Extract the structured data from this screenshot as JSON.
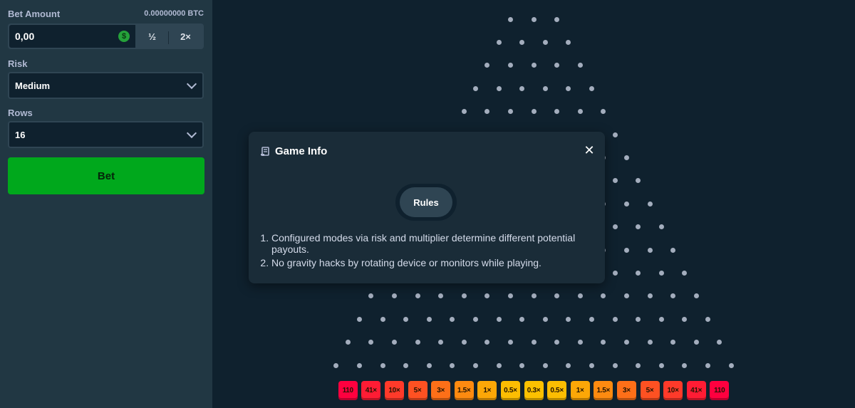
{
  "bet": {
    "label": "Bet Amount",
    "balance": "0.00000000 BTC",
    "value": "0,00",
    "coin_icon": "dollar-coin-icon",
    "half_label": "½",
    "double_label": "2×"
  },
  "risk": {
    "label": "Risk",
    "value": "Medium"
  },
  "rows": {
    "label": "Rows",
    "value": "16"
  },
  "bet_button": {
    "label": "Bet"
  },
  "board": {
    "peg_rows": 16,
    "top_row_pegs": 3,
    "multipliers": [
      "110",
      "41×",
      "10×",
      "5×",
      "3×",
      "1.5×",
      "1×",
      "0.5×",
      "0.3×",
      "0.5×",
      "1×",
      "1.5×",
      "3×",
      "5×",
      "10×",
      "41×",
      "110"
    ],
    "bucket_colors": [
      "#ff003f",
      "#ff1c34",
      "#ff3a2a",
      "#fe5122",
      "#fd6f18",
      "#fd8a10",
      "#fca707",
      "#fcbd02",
      "#fcc000",
      "#fcbd02",
      "#fca707",
      "#fd8a10",
      "#fd6f18",
      "#fe5122",
      "#ff3a2a",
      "#ff1c34",
      "#ff003f"
    ],
    "peg_color": "#a3adbd"
  },
  "modal": {
    "title": "Game Info",
    "title_icon": "scroll-icon",
    "close_icon": "close-icon",
    "tab_label": "Rules",
    "rules": [
      "Configured modes via risk and multiplier determine different potential payouts.",
      "No gravity hacks by rotating device or monitors while playing."
    ]
  },
  "colors": {
    "background": "#0f212e",
    "panel": "#213743",
    "accent_green": "#00a81c",
    "modal": "#1a2c38"
  }
}
